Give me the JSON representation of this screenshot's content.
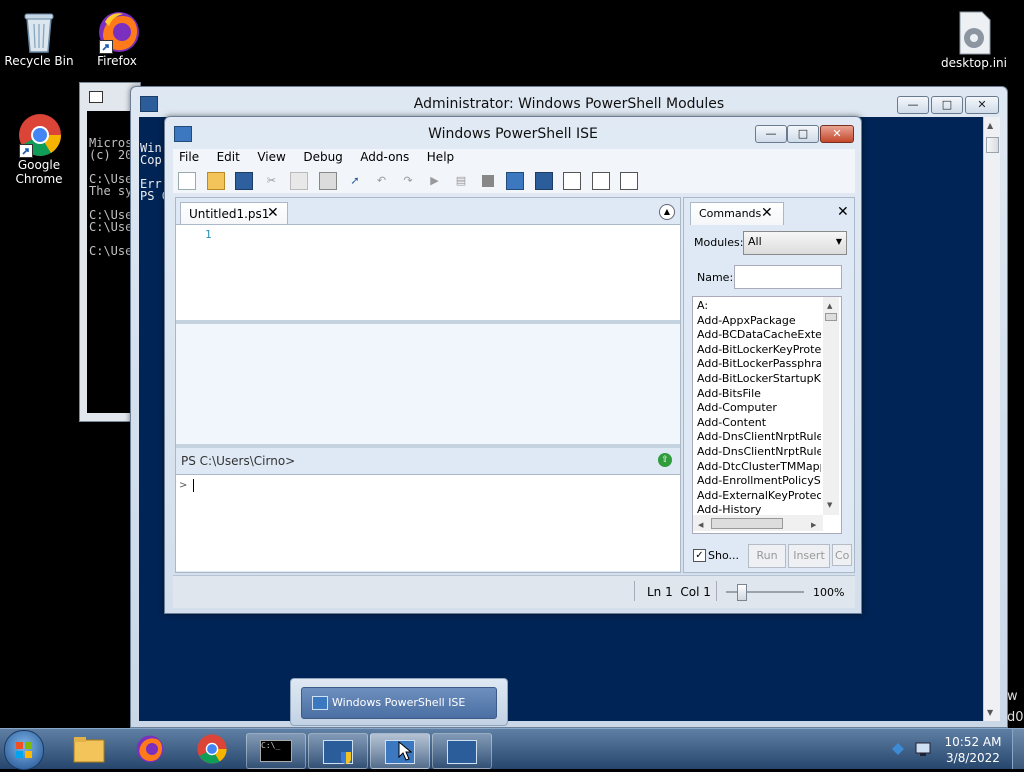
{
  "desktop": {
    "icons": [
      {
        "label": "Recycle Bin"
      },
      {
        "label": "Firefox"
      },
      {
        "label": "Google Chrome"
      },
      {
        "label": "desktop.ini"
      }
    ]
  },
  "cmd_window": {
    "lines": [
      "Micros",
      "(c) 20",
      "",
      "C:\\Use",
      "The sy",
      "",
      "C:\\Use",
      "C:\\Use",
      "",
      "C:\\Use"
    ]
  },
  "ps_modules_window": {
    "title": "Administrator: Windows PowerShell Modules",
    "lines": [
      "Win",
      "Cop",
      "",
      "Err",
      "PS C"
    ],
    "edge_text": [
      "w",
      "d0"
    ]
  },
  "ise": {
    "title": "Windows PowerShell ISE",
    "menu": [
      "File",
      "Edit",
      "View",
      "Debug",
      "Add-ons",
      "Help"
    ],
    "script_tab": "Untitled1.ps1",
    "line_number": "1",
    "console_prompt": "PS C:\\Users\\Cirno>",
    "console_caret": ">",
    "status": {
      "position": "Ln 1  Col 1",
      "zoom": "100%"
    },
    "commands": {
      "tab_label": "Commands",
      "modules_label": "Modules:",
      "modules_value": "All",
      "name_label": "Name:",
      "items": [
        "A:",
        "Add-AppxPackage",
        "Add-BCDataCacheExtension",
        "Add-BitLockerKeyProtector",
        "Add-BitLockerPassphraseProtector",
        "Add-BitLockerStartupKey",
        "Add-BitsFile",
        "Add-Computer",
        "Add-Content",
        "Add-DnsClientNrptRule",
        "Add-DnsClientNrptRule",
        "Add-DtcClusterTMMapping",
        "Add-EnrollmentPolicyServer",
        "Add-ExternalKeyProtector",
        "Add-History"
      ],
      "show_label": "Sho...",
      "run_label": "Run",
      "insert_label": "Insert",
      "copy_label": "Co"
    }
  },
  "taskbar_popup": {
    "label": "Windows PowerShell ISE"
  },
  "clock": {
    "time": "10:52 AM",
    "date": "3/8/2022"
  },
  "colors": {
    "ps_blue": "#012456",
    "ise_header": "#dfe9f5",
    "taskbar": "#3b5a82"
  }
}
